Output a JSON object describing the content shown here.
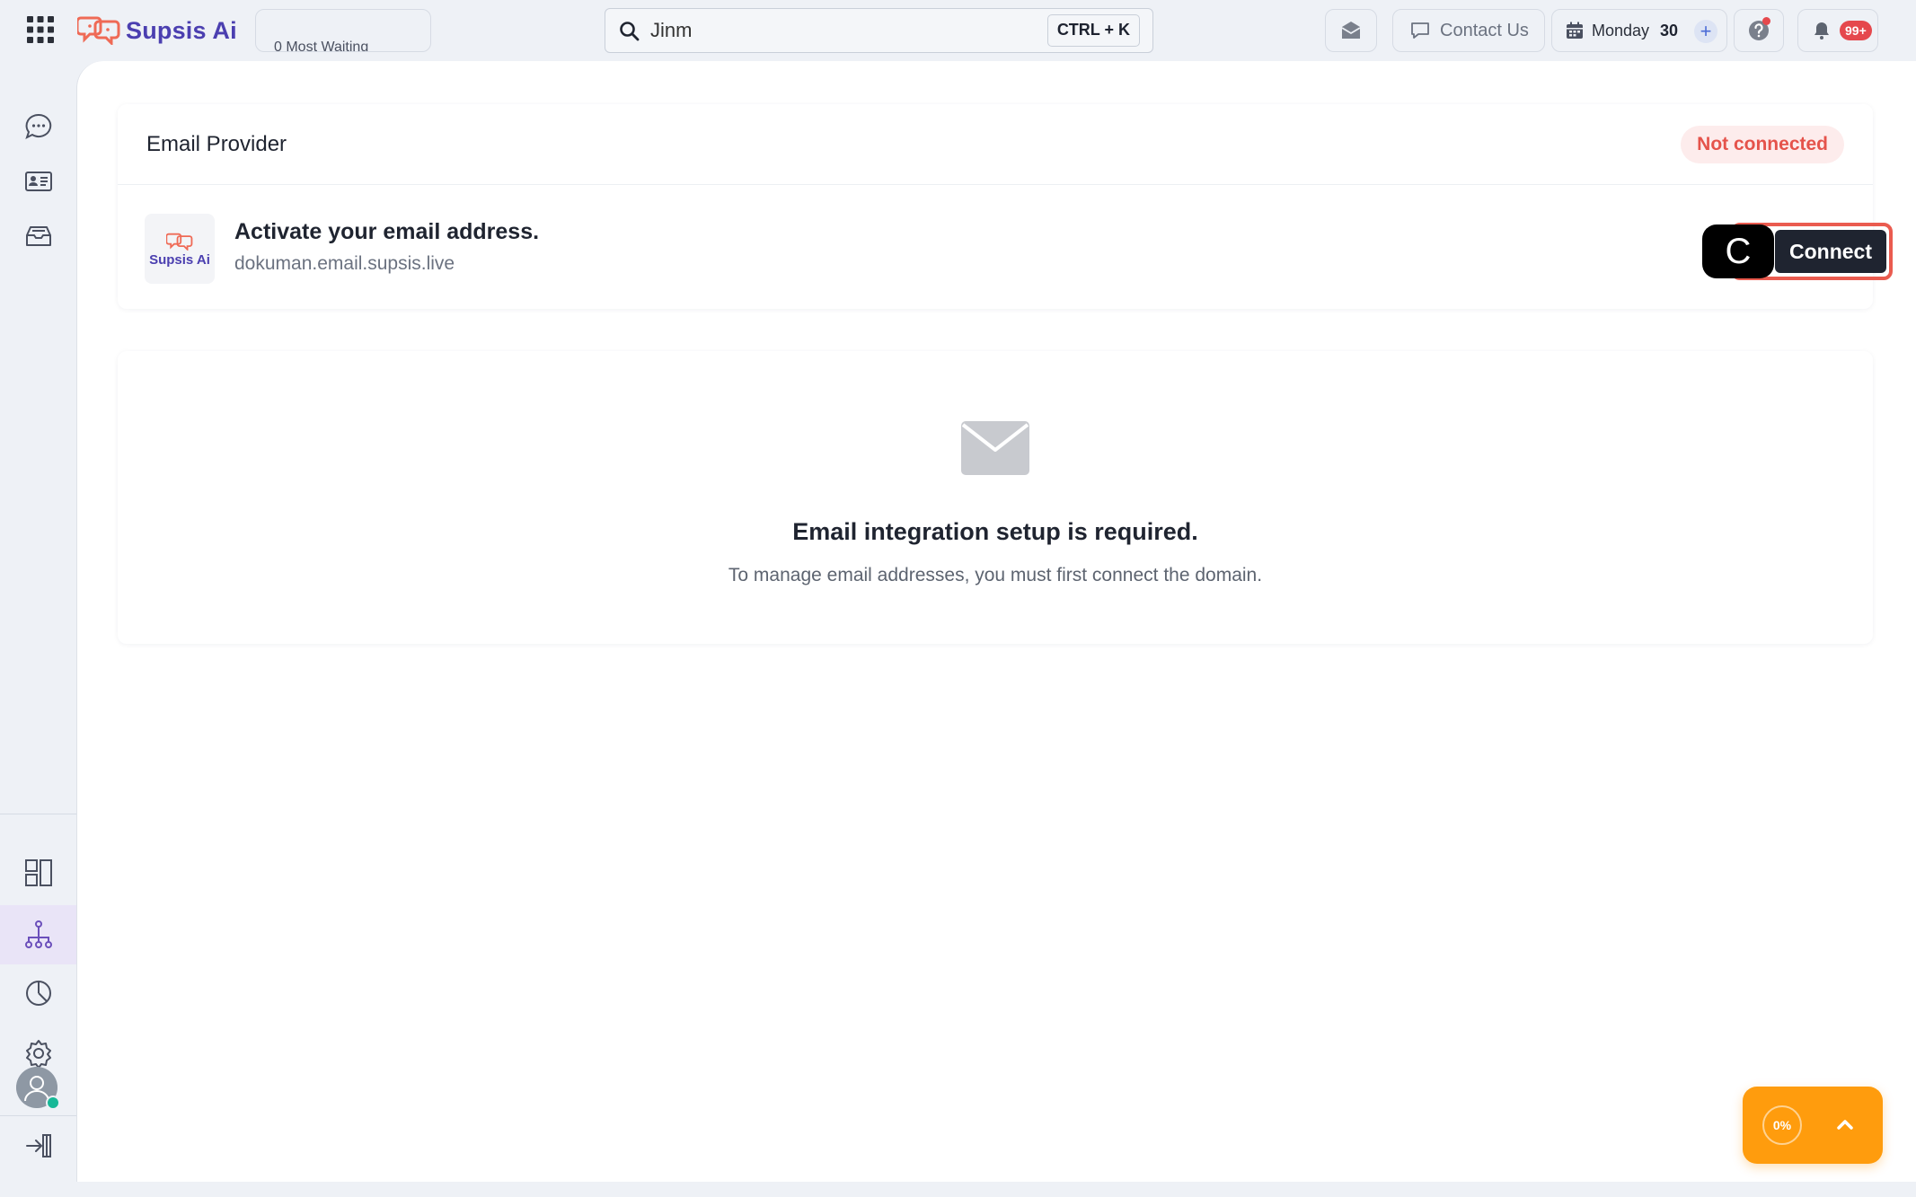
{
  "header": {
    "brand_name": "Supsis Ai",
    "waiting_label": "0 Most Waiting",
    "search": {
      "value": "Jinm",
      "placeholder": "Search",
      "shortcut": "CTRL + K"
    },
    "contact_label": "Contact Us",
    "date": {
      "day": "Monday",
      "num": "30"
    },
    "notifications_badge": "99+",
    "icons": [
      "apps-grid-icon",
      "mail-icon",
      "chat-icon",
      "calendar-icon",
      "plus-icon",
      "help-icon",
      "bell-icon"
    ]
  },
  "sidebar": {
    "items": [
      {
        "name": "conversations",
        "icon": "chat-bubble-icon",
        "active": false
      },
      {
        "name": "contacts",
        "icon": "contact-card-icon",
        "active": false
      },
      {
        "name": "inbox",
        "icon": "inbox-icon",
        "active": false
      },
      {
        "name": "dashboard",
        "icon": "layout-icon",
        "active": false
      },
      {
        "name": "integrations",
        "icon": "network-icon",
        "active": true
      },
      {
        "name": "reports",
        "icon": "pie-chart-icon",
        "active": false
      },
      {
        "name": "settings",
        "icon": "gear-icon",
        "active": false
      },
      {
        "name": "logout",
        "icon": "logout-icon",
        "active": false
      }
    ],
    "accent": "#6b4fbb"
  },
  "provider": {
    "title": "Email Provider",
    "status": "Not connected",
    "logo_text": "Supsis Ai",
    "activate_title": "Activate your email address.",
    "domain": "dokuman.email.supsis.live",
    "connect_key": "C",
    "connect_label": "Connect"
  },
  "empty_state": {
    "icon": "envelope-icon",
    "title": "Email integration setup is required.",
    "description": "To manage email addresses, you must first connect the domain."
  },
  "progress": {
    "value": "0%"
  },
  "colors": {
    "brand": "#4b3fb0",
    "status_red": "#e5534b",
    "orange": "#ff9c0d",
    "dark": "#1f2430"
  }
}
